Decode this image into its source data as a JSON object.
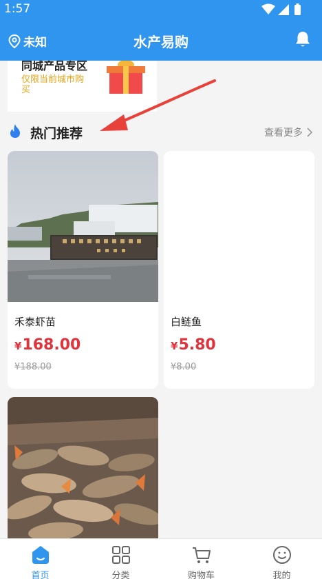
{
  "status_bar": {
    "time": "1:57"
  },
  "header": {
    "location": "未知",
    "title": "水产易购"
  },
  "promo": {
    "title": "同城产品专区",
    "subtitle": "仅限当前城市购买"
  },
  "hot_section": {
    "title": "热门推荐",
    "more_label": "查看更多"
  },
  "currency_symbol": "¥",
  "products": [
    {
      "name": "禾泰虾苗",
      "price": "168.00",
      "original_price": "¥188.00"
    },
    {
      "name": "白鲢鱼",
      "price": "5.80",
      "original_price": "¥8.00"
    }
  ],
  "tabbar": {
    "items": [
      {
        "label": "首页",
        "icon": "home-icon",
        "active": true
      },
      {
        "label": "分类",
        "icon": "grid-icon",
        "active": false
      },
      {
        "label": "购物车",
        "icon": "cart-icon",
        "active": false
      },
      {
        "label": "我的",
        "icon": "profile-icon",
        "active": false
      }
    ]
  },
  "colors": {
    "primary": "#2f95ee",
    "price": "#e0333b",
    "promo_sub": "#e8a317",
    "annotation_arrow": "#e8413a"
  }
}
